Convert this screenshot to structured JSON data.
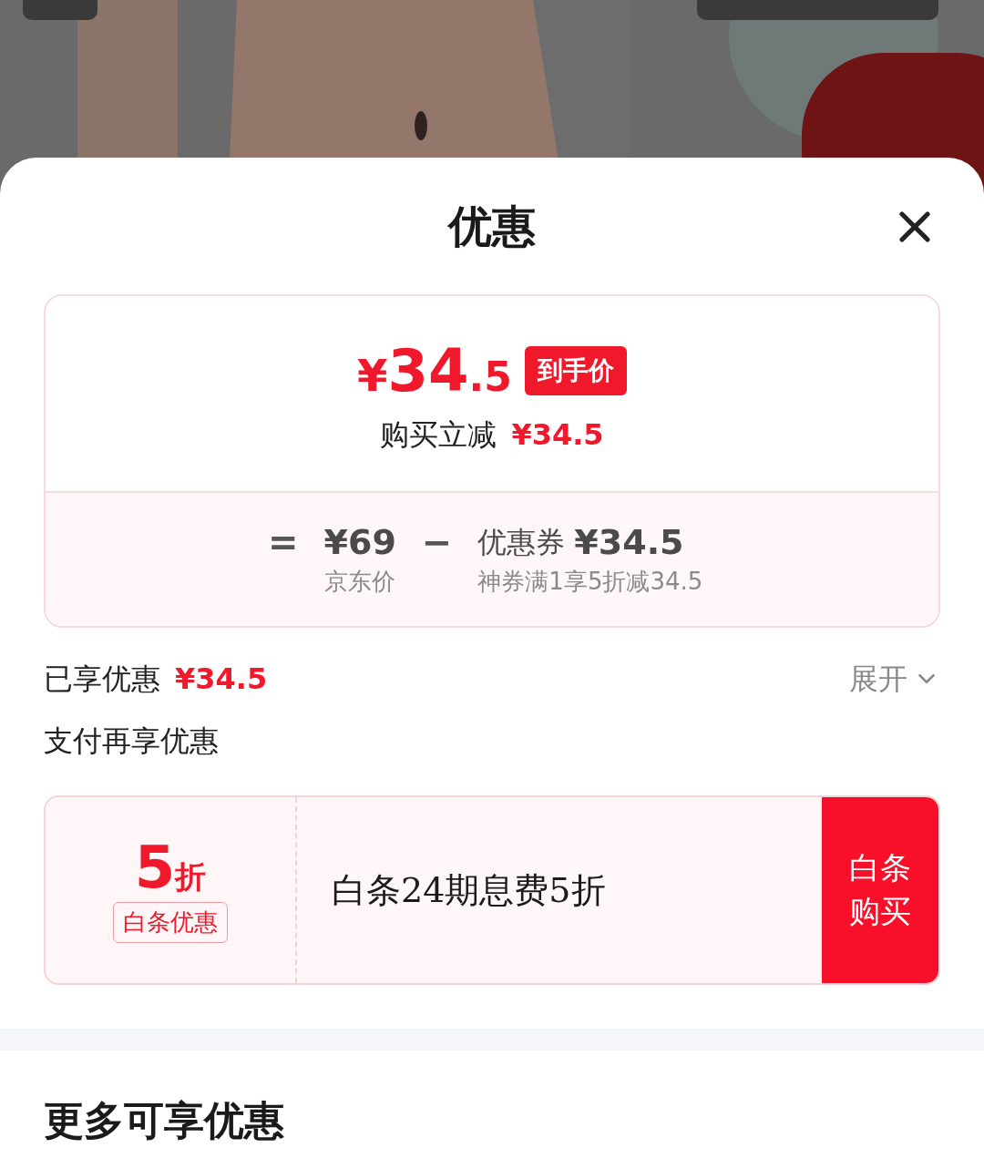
{
  "title": "优惠",
  "final_price": {
    "symbol": "¥",
    "integer": "34",
    "decimal": ".5",
    "badge": "到手价"
  },
  "instant_discount": {
    "label": "购买立减",
    "amount": "¥34.5"
  },
  "formula": {
    "equals": "=",
    "minus": "−",
    "terms": [
      {
        "value": "¥69",
        "caption": "京东价"
      },
      {
        "label": "优惠券",
        "value": "¥34.5",
        "caption": "神券满1享5折减34.5"
      }
    ]
  },
  "enjoyed": {
    "label": "已享优惠",
    "amount": "¥34.5",
    "toggle": "展开",
    "expanded": false
  },
  "pay_section": {
    "title": "支付再享优惠",
    "offer": {
      "discount": "5",
      "unit": "折",
      "tag": "白条优惠",
      "description": "白条24期息费5折",
      "action": "白条购买"
    }
  },
  "more_section": {
    "title": "更多可享优惠"
  }
}
